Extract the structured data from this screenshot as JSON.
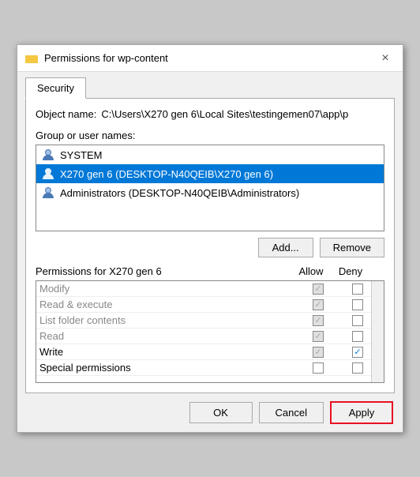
{
  "window": {
    "title": "Permissions for wp-content",
    "close_label": "×"
  },
  "tabs": [
    {
      "label": "Security",
      "active": true
    }
  ],
  "object_name": {
    "label": "Object name:",
    "value": "C:\\Users\\X270 gen 6\\Local Sites\\testingemen07\\app\\p"
  },
  "group_section": {
    "label": "Group or user names:",
    "users": [
      {
        "id": "system",
        "name": "SYSTEM",
        "selected": false,
        "icon": "system"
      },
      {
        "id": "x270",
        "name": "X270 gen 6 (DESKTOP-N40QEIB\\X270 gen 6)",
        "selected": true,
        "icon": "user"
      },
      {
        "id": "admins",
        "name": "Administrators (DESKTOP-N40QEIB\\Administrators)",
        "selected": false,
        "icon": "user"
      }
    ]
  },
  "buttons": {
    "add_label": "Add...",
    "remove_label": "Remove"
  },
  "permissions": {
    "title_prefix": "Permissions for",
    "title_user": "X270 gen 6",
    "col_allow": "Allow",
    "col_deny": "Deny",
    "rows": [
      {
        "name": "Modify",
        "allow": false,
        "deny": false,
        "grayed": true
      },
      {
        "name": "Read & execute",
        "allow": true,
        "deny": false,
        "grayed": true
      },
      {
        "name": "List folder contents",
        "allow": true,
        "deny": false,
        "grayed": true
      },
      {
        "name": "Read",
        "allow": true,
        "deny": false,
        "grayed": true
      },
      {
        "name": "Write",
        "allow": true,
        "deny": true,
        "grayed": false
      },
      {
        "name": "Special permissions",
        "allow": false,
        "deny": false,
        "grayed": false
      }
    ]
  },
  "footer": {
    "ok_label": "OK",
    "cancel_label": "Cancel",
    "apply_label": "Apply"
  }
}
